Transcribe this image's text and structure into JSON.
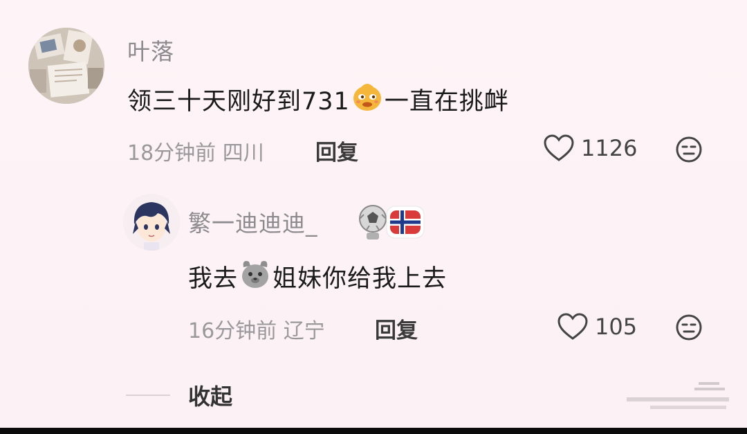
{
  "comment": {
    "username": "叶落",
    "text_before_emoji": "领三十天刚好到731",
    "text_after_emoji": "一直在挑衅",
    "time": "18分钟前",
    "location": "四川",
    "reply_label": "回复",
    "likes": "1126",
    "emoji_icon": "smug-face-emoji-icon",
    "dislike_icon": "unhappy-face-icon"
  },
  "reply": {
    "username": "繁一迪迪迪_",
    "badges": [
      "soccer-ball-badge-icon",
      "norway-flag-badge-icon"
    ],
    "text_before_emoji": "我去",
    "text_after_emoji": "姐妹你给我上去",
    "time": "16分钟前",
    "location": "辽宁",
    "reply_label": "回复",
    "likes": "105",
    "emoji_icon": "dog-face-emoji-icon",
    "dislike_icon": "unhappy-face-icon"
  },
  "collapse_label": "收起",
  "colors": {
    "background": "#fdf3f6",
    "username": "#8c8a8d",
    "text": "#1a1a1a",
    "meta": "#9a989b"
  }
}
